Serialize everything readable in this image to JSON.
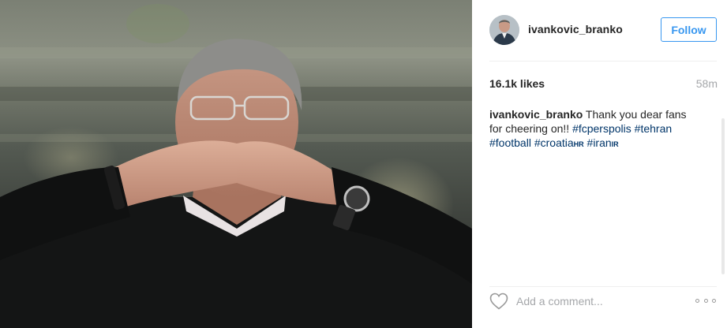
{
  "post": {
    "author": {
      "username": "ivankovic_branko",
      "follow_label": "Follow"
    },
    "likes_text": "16.1k likes",
    "time_text": "58m",
    "caption": {
      "username": "ivankovic_branko",
      "text": "Thank you dear fans for cheering on!!",
      "hashtags": [
        "#fcperspolis",
        "#tehran",
        "#football",
        "#croatia",
        "#iran"
      ],
      "flags": [
        "HR",
        "IR"
      ]
    },
    "comment_placeholder": "Add a comment..."
  },
  "icons": {
    "like": "heart-outline-icon",
    "more": "more-options-icon"
  },
  "colors": {
    "accent": "#3897f0",
    "hashtag": "#003569",
    "muted": "#a5a7aa",
    "text": "#262626"
  }
}
